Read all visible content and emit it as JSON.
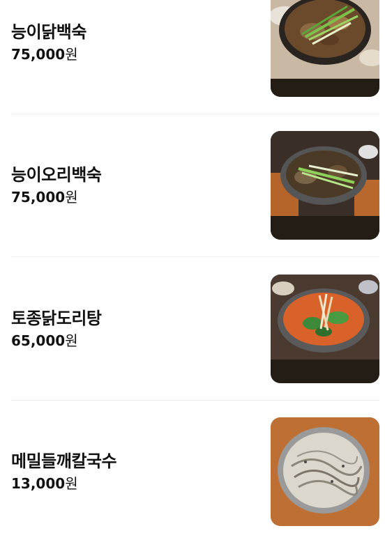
{
  "menu": {
    "items": [
      {
        "name": "능이닭백숙",
        "price": "75,000",
        "unit": "원",
        "image": "food-photo"
      },
      {
        "name": "능이오리백숙",
        "price": "75,000",
        "unit": "원",
        "image": "food-photo"
      },
      {
        "name": "토종닭도리탕",
        "price": "65,000",
        "unit": "원",
        "image": "food-photo"
      },
      {
        "name": "메밀들깨칼국수",
        "price": "13,000",
        "unit": "원",
        "image": "food-photo"
      }
    ]
  }
}
